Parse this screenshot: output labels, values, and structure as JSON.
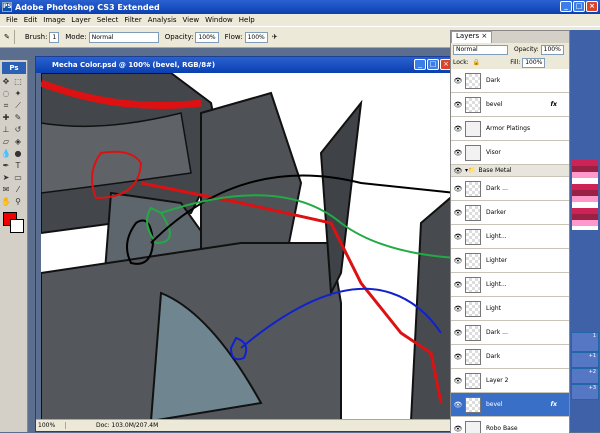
{
  "app": {
    "title": "Adobe Photoshop CS3 Extended",
    "icon": "PS"
  },
  "menu": [
    "File",
    "Edit",
    "Image",
    "Layer",
    "Select",
    "Filter",
    "Analysis",
    "View",
    "Window",
    "Help"
  ],
  "options": {
    "brush_label": "Brush:",
    "brush_size": "1",
    "mode_label": "Mode:",
    "mode_value": "Normal",
    "opacity_label": "Opacity:",
    "opacity_value": "100%",
    "flow_label": "Flow:",
    "flow_value": "100%"
  },
  "toolbox": {
    "logo": "Ps"
  },
  "document": {
    "title": "Mecha Color.psd @ 100% (bevel, RGB/8#)",
    "zoom": "100%",
    "doc_info": "Doc: 103.0M/207.4M"
  },
  "layers_panel": {
    "tab": "Layers ×",
    "blend": "Normal",
    "opacity_label": "Opacity:",
    "opacity": "100%",
    "lock_label": "Lock:",
    "fill_label": "Fill:",
    "fill": "100%",
    "layers": [
      {
        "name": "Dark",
        "thumb": "checker"
      },
      {
        "name": "bevel",
        "thumb": "checker",
        "fx": "fx"
      },
      {
        "name": "Armor Platings",
        "thumb": "plain"
      },
      {
        "name": "Visor",
        "thumb": "plain"
      },
      {
        "name": "Base Metal",
        "group": true
      },
      {
        "name": "Dark ...",
        "thumb": "checker"
      },
      {
        "name": "Darker",
        "thumb": "checker"
      },
      {
        "name": "Light...",
        "thumb": "checker"
      },
      {
        "name": "Lighter",
        "thumb": "checker"
      },
      {
        "name": "Light...",
        "thumb": "checker"
      },
      {
        "name": "Light",
        "thumb": "checker"
      },
      {
        "name": "Dark ...",
        "thumb": "checker"
      },
      {
        "name": "Dark",
        "thumb": "checker"
      },
      {
        "name": "Layer 2",
        "thumb": "checker"
      },
      {
        "name": "bevel",
        "thumb": "checker",
        "fx": "fx",
        "selected": true
      },
      {
        "name": "Robo Base",
        "thumb": "plain"
      }
    ]
  },
  "right_panels": [
    "1",
    "+1",
    "+2",
    "+3"
  ],
  "colors": {
    "title": "#0a3fb0",
    "canvas": "#ffffff",
    "metal": "#4a4e52",
    "red": "#dd1111",
    "green": "#22aa44",
    "blue": "#1122cc"
  }
}
